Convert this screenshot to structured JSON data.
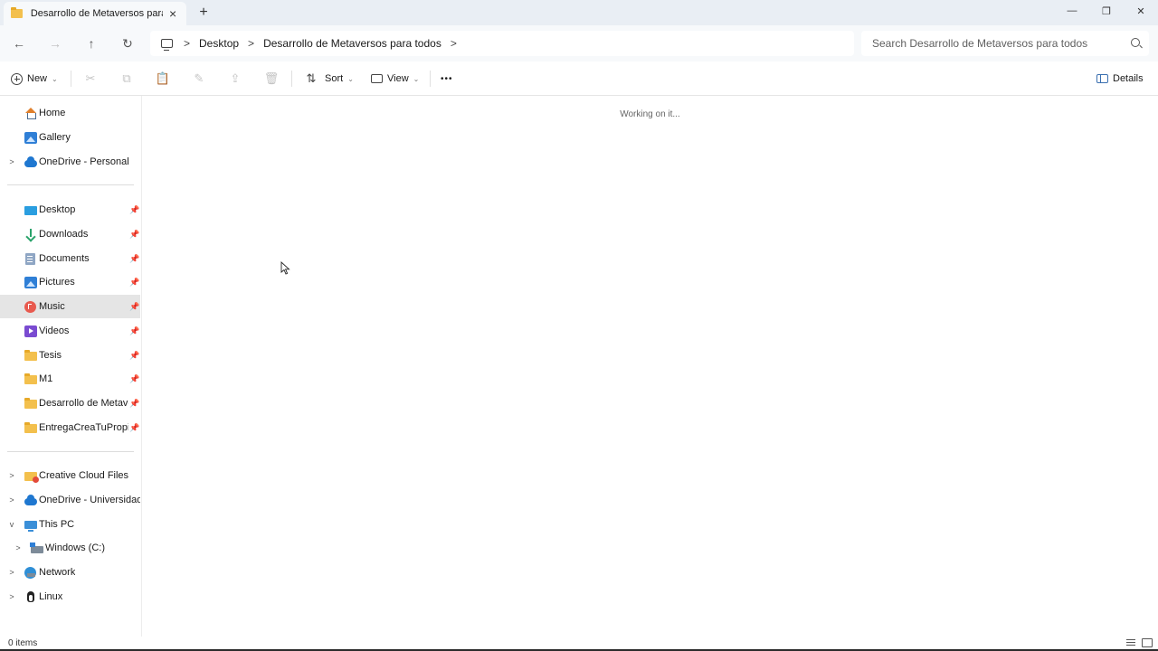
{
  "window": {
    "tab_title": "Desarrollo de Metaversos para todos",
    "tab_close": "×",
    "new_tab": "+",
    "controls": {
      "minimize": "—",
      "maximize": "❐",
      "close": "✕"
    }
  },
  "addressbar": {
    "back": "←",
    "forward": "→",
    "up": "↑",
    "refresh": "↻",
    "breadcrumb": [
      "Desktop",
      "Desarrollo de Metaversos para todos"
    ],
    "separator": ">",
    "search_placeholder": "Search Desarrollo de Metaversos para todos"
  },
  "commandbar": {
    "new_label": "New",
    "sort_label": "Sort",
    "view_label": "View",
    "more_label": "•••",
    "details_label": "Details",
    "chevron": "⌄",
    "icons": {
      "cut": "✂",
      "copy": "⧉",
      "paste": "📋",
      "rename": "✎",
      "share": "⇪",
      "delete": "🗑",
      "sort": "⇅"
    }
  },
  "sidebar": {
    "quick": [
      {
        "label": "Home",
        "icon": "home-icon"
      },
      {
        "label": "Gallery",
        "icon": "gallery-icon"
      },
      {
        "label": "OneDrive - Personal",
        "icon": "cloud-icon",
        "expandable": true
      }
    ],
    "pinned": [
      {
        "label": "Desktop",
        "icon": "desktop-icon"
      },
      {
        "label": "Downloads",
        "icon": "download-icon"
      },
      {
        "label": "Documents",
        "icon": "document-icon"
      },
      {
        "label": "Pictures",
        "icon": "pictures-icon"
      },
      {
        "label": "Music",
        "icon": "music-icon",
        "selected": true
      },
      {
        "label": "Videos",
        "icon": "video-icon"
      },
      {
        "label": "Tesis",
        "icon": "folder-icon"
      },
      {
        "label": "M1",
        "icon": "folder-icon"
      },
      {
        "label": "Desarrollo de Metaversos para todos",
        "icon": "folder-icon"
      },
      {
        "label": "EntregaCreaTuPropioEspacio",
        "icon": "folder-icon"
      }
    ],
    "pin_glyph": "📌",
    "locations": [
      {
        "label": "Creative Cloud Files",
        "icon": "creative-cloud-icon"
      },
      {
        "label": "OneDrive - Universidad de",
        "icon": "cloud-icon"
      },
      {
        "label": "This PC",
        "icon": "pc-icon",
        "expanded": true
      },
      {
        "label": "Windows (C:)",
        "icon": "drive-icon"
      },
      {
        "label": "Network",
        "icon": "network-icon"
      },
      {
        "label": "Linux",
        "icon": "linux-icon"
      }
    ],
    "expand_glyph": ">",
    "expanded_glyph": "v"
  },
  "content": {
    "status_message": "Working on it..."
  },
  "statusbar": {
    "item_count": "0 items"
  },
  "colors": {
    "titlebar_bg": "#e9eef4",
    "selected_bg": "#e5e5e5",
    "folder": "#f3c04d",
    "accent": "#2f7fd6"
  }
}
